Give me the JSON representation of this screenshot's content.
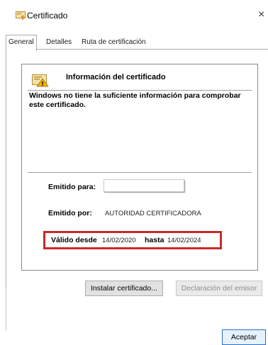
{
  "window": {
    "title": "Certificado",
    "close_glyph": "×"
  },
  "tabs": [
    {
      "label": "General",
      "active": true
    },
    {
      "label": "Detalles",
      "active": false
    },
    {
      "label": "Ruta de certificación",
      "active": false
    }
  ],
  "info": {
    "title": "Información del certificado",
    "message": "Windows no tiene la suficiente información para comprobar este certificado."
  },
  "fields": {
    "issued_to_label": "Emitido para:",
    "issued_to_value": "",
    "issued_by_label": "Emitido por:",
    "issued_by_value": "AUTORIDAD CERTIFICADORA",
    "valid_from_label": "Válido desde",
    "valid_from_value": "14/02/2020",
    "valid_to_label": "hasta",
    "valid_to_value": "14/02/2024"
  },
  "buttons": {
    "install": "Instalar certificado...",
    "declaration": "Declaración del emisor",
    "accept": "Aceptar"
  },
  "colors": {
    "highlight": "#c9292b",
    "accent": "#2b6fc4"
  },
  "icons": {
    "title": "certificate-icon",
    "info": "certificate-warning-icon"
  }
}
